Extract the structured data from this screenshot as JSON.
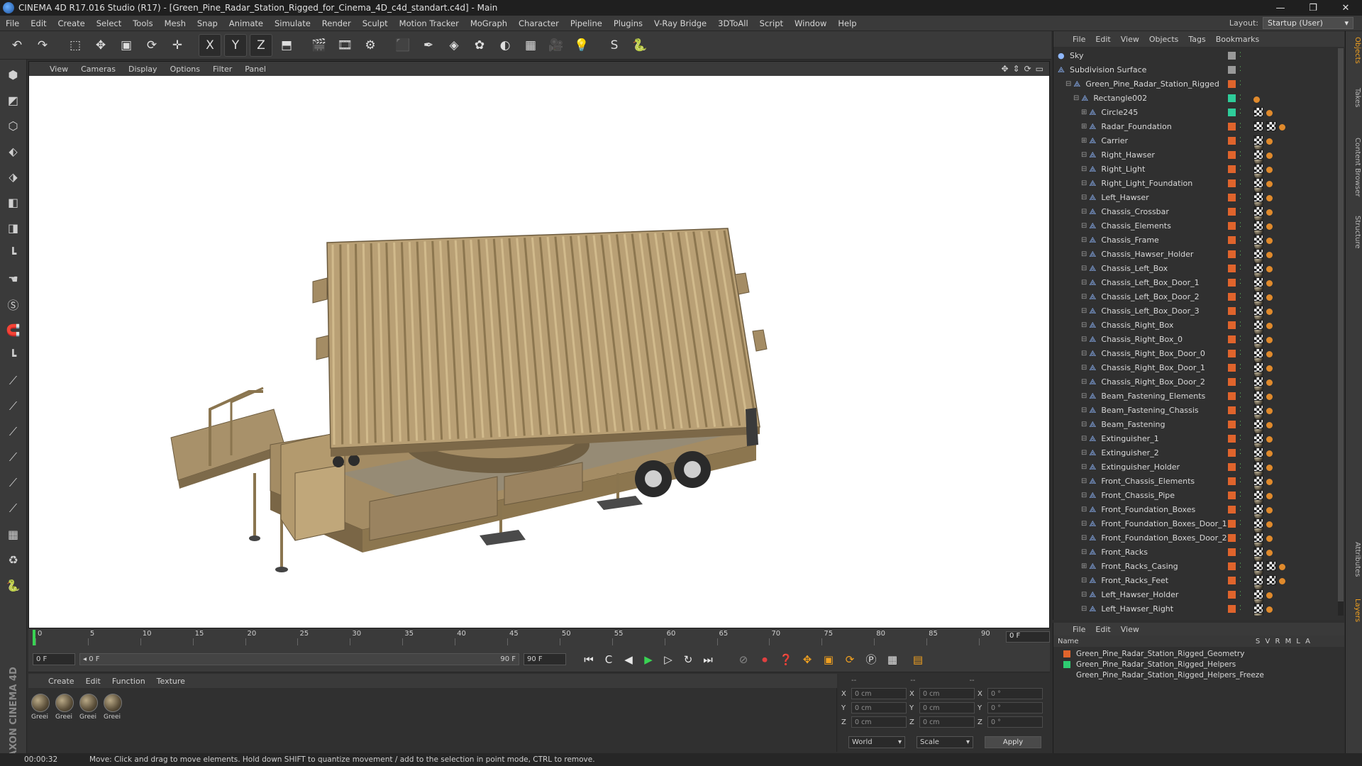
{
  "window": {
    "title": "CINEMA 4D R17.016 Studio (R17) - [Green_Pine_Radar_Station_Rigged_for_Cinema_4D_c4d_standart.c4d] - Main",
    "minimize": "—",
    "maximize": "❐",
    "close": "✕"
  },
  "menu": {
    "items": [
      "File",
      "Edit",
      "Create",
      "Select",
      "Tools",
      "Mesh",
      "Snap",
      "Animate",
      "Simulate",
      "Render",
      "Sculpt",
      "Motion Tracker",
      "MoGraph",
      "Character",
      "Pipeline",
      "Plugins",
      "V-Ray Bridge",
      "3DToAll",
      "Script",
      "Window",
      "Help"
    ],
    "layout_label": "Layout:",
    "layout_value": "Startup (User)"
  },
  "toolbar": {
    "icons": [
      {
        "name": "undo-icon",
        "glyph": "↶"
      },
      {
        "name": "redo-icon",
        "glyph": "↷"
      },
      {
        "name": "live-selection-icon",
        "glyph": "⬚"
      },
      {
        "name": "move-icon",
        "glyph": "✥"
      },
      {
        "name": "scale-icon",
        "glyph": "▣"
      },
      {
        "name": "rotate-icon",
        "glyph": "⟳"
      },
      {
        "name": "transform-icon",
        "glyph": "✛"
      },
      {
        "name": "x-axis-icon",
        "glyph": "X"
      },
      {
        "name": "y-axis-icon",
        "glyph": "Y"
      },
      {
        "name": "z-axis-icon",
        "glyph": "Z"
      },
      {
        "name": "coordinate-system-icon",
        "glyph": "⬒"
      },
      {
        "name": "render-view-icon",
        "glyph": "🎬"
      },
      {
        "name": "render-picture-viewer-icon",
        "glyph": "🎞"
      },
      {
        "name": "render-settings-icon",
        "glyph": "⚙"
      },
      {
        "name": "cube-icon",
        "glyph": "⬛"
      },
      {
        "name": "pen-icon",
        "glyph": "✒"
      },
      {
        "name": "subdivision-icon",
        "glyph": "◈"
      },
      {
        "name": "array-icon",
        "glyph": "✿"
      },
      {
        "name": "deformer-icon",
        "glyph": "◐"
      },
      {
        "name": "floor-icon",
        "glyph": "▦"
      },
      {
        "name": "camera-icon",
        "glyph": "🎥"
      },
      {
        "name": "light-icon",
        "glyph": "💡"
      },
      {
        "name": "sketch-icon",
        "glyph": "S"
      },
      {
        "name": "python-icon",
        "glyph": "🐍"
      }
    ]
  },
  "left_tools": [
    "⬢",
    "◩",
    "⬡",
    "⬖",
    "⬗",
    "◧",
    "◨",
    "┗",
    "☚",
    "Ⓢ",
    "🧲",
    "┗",
    "⟋",
    "⟋",
    "⟋",
    "⟋",
    "⟋",
    "⟋",
    "▦",
    "♻",
    "🐍"
  ],
  "maxon_logo": "MAXON CINEMA 4D",
  "viewport": {
    "menu": [
      "View",
      "Cameras",
      "Display",
      "Options",
      "Filter",
      "Panel"
    ],
    "nav_icons": [
      "✥",
      "⇕",
      "⟳",
      "▭"
    ]
  },
  "timeline": {
    "ticks": [
      "0",
      "5",
      "10",
      "15",
      "20",
      "25",
      "30",
      "35",
      "40",
      "45",
      "50",
      "55",
      "60",
      "65",
      "70",
      "75",
      "80",
      "85",
      "90"
    ],
    "current_frame": "0 F"
  },
  "transport": {
    "start_field": "0 F",
    "range_start": "◂ 0 F",
    "range_end": "90 F",
    "end_field": "90 F",
    "buttons": [
      "⏮",
      "C",
      "◀",
      "▶",
      "▷",
      "↻",
      "⏭"
    ]
  },
  "materials": {
    "menu": [
      "Create",
      "Edit",
      "Function",
      "Texture"
    ],
    "items": [
      "Greei",
      "Greei",
      "Greei",
      "Greei"
    ]
  },
  "coords": {
    "header": [
      "--",
      "--",
      "--"
    ],
    "rows": [
      {
        "a": "X",
        "v1": "0 cm",
        "b": "X",
        "v2": "0 cm",
        "c": "X",
        "v3": "0 °"
      },
      {
        "a": "Y",
        "v1": "0 cm",
        "b": "Y",
        "v2": "0 cm",
        "c": "Y",
        "v3": "0 °"
      },
      {
        "a": "Z",
        "v1": "0 cm",
        "b": "Z",
        "v2": "0 cm",
        "c": "Z",
        "v3": "0 °"
      }
    ],
    "world": "World",
    "scale": "Scale",
    "apply": "Apply"
  },
  "status": {
    "time": "00:00:32",
    "message": "Move: Click and drag to move elements. Hold down SHIFT to quantize movement / add to the selection in point mode, CTRL to remove."
  },
  "object_manager": {
    "menu": [
      "File",
      "Edit",
      "View",
      "Objects",
      "Tags",
      "Bookmarks"
    ],
    "objects": [
      {
        "name": "Sky",
        "indent": 0,
        "color": "#999999",
        "tags": []
      },
      {
        "name": "Subdivision Surface",
        "indent": 0,
        "color": "#999999",
        "tags": []
      },
      {
        "name": "Green_Pine_Radar_Station_Rigged",
        "indent": 1,
        "color": "#e0642c",
        "tags": []
      },
      {
        "name": "Rectangle002",
        "indent": 2,
        "color": "#2ecc9a",
        "tags": [
          "dot"
        ]
      },
      {
        "name": "Circle245",
        "indent": 3,
        "color": "#2ecc9a",
        "tags": [
          "chk",
          "dot"
        ]
      },
      {
        "name": "Radar_Foundation",
        "indent": 3,
        "color": "#e0642c",
        "tags": [
          "chk",
          "mat",
          "chk",
          "dot"
        ]
      },
      {
        "name": "Carrier",
        "indent": 3,
        "color": "#e0642c",
        "tags": [
          "mat",
          "chk",
          "dot"
        ]
      },
      {
        "name": "Right_Hawser",
        "indent": 3,
        "color": "#e0642c",
        "tags": [
          "mat",
          "chk",
          "dot"
        ]
      },
      {
        "name": "Right_Light",
        "indent": 3,
        "color": "#e0642c",
        "tags": [
          "mat",
          "chk",
          "dot"
        ]
      },
      {
        "name": "Right_Light_Foundation",
        "indent": 3,
        "color": "#e0642c",
        "tags": [
          "mat",
          "chk",
          "dot"
        ]
      },
      {
        "name": "Left_Hawser",
        "indent": 3,
        "color": "#e0642c",
        "tags": [
          "mat",
          "chk",
          "dot"
        ]
      },
      {
        "name": "Chassis_Crossbar",
        "indent": 3,
        "color": "#e0642c",
        "tags": [
          "mat",
          "chk",
          "dot"
        ]
      },
      {
        "name": "Chassis_Elements",
        "indent": 3,
        "color": "#e0642c",
        "tags": [
          "mat",
          "chk",
          "dot"
        ]
      },
      {
        "name": "Chassis_Frame",
        "indent": 3,
        "color": "#e0642c",
        "tags": [
          "mat",
          "chk",
          "dot"
        ]
      },
      {
        "name": "Chassis_Hawser_Holder",
        "indent": 3,
        "color": "#e0642c",
        "tags": [
          "mat",
          "chk",
          "dot"
        ]
      },
      {
        "name": "Chassis_Left_Box",
        "indent": 3,
        "color": "#e0642c",
        "tags": [
          "mat",
          "chk",
          "dot"
        ]
      },
      {
        "name": "Chassis_Left_Box_Door_1",
        "indent": 3,
        "color": "#e0642c",
        "tags": [
          "mat",
          "chk",
          "dot"
        ]
      },
      {
        "name": "Chassis_Left_Box_Door_2",
        "indent": 3,
        "color": "#e0642c",
        "tags": [
          "mat",
          "chk",
          "dot"
        ]
      },
      {
        "name": "Chassis_Left_Box_Door_3",
        "indent": 3,
        "color": "#e0642c",
        "tags": [
          "mat",
          "chk",
          "dot"
        ]
      },
      {
        "name": "Chassis_Right_Box",
        "indent": 3,
        "color": "#e0642c",
        "tags": [
          "mat",
          "chk",
          "dot"
        ]
      },
      {
        "name": "Chassis_Right_Box_0",
        "indent": 3,
        "color": "#e0642c",
        "tags": [
          "mat",
          "chk",
          "dot"
        ]
      },
      {
        "name": "Chassis_Right_Box_Door_0",
        "indent": 3,
        "color": "#e0642c",
        "tags": [
          "mat",
          "chk",
          "dot"
        ]
      },
      {
        "name": "Chassis_Right_Box_Door_1",
        "indent": 3,
        "color": "#e0642c",
        "tags": [
          "mat",
          "chk",
          "dot"
        ]
      },
      {
        "name": "Chassis_Right_Box_Door_2",
        "indent": 3,
        "color": "#e0642c",
        "tags": [
          "mat",
          "chk",
          "dot"
        ]
      },
      {
        "name": "Beam_Fastening_Elements",
        "indent": 3,
        "color": "#e0642c",
        "tags": [
          "mat",
          "chk",
          "dot"
        ]
      },
      {
        "name": "Beam_Fastening_Chassis",
        "indent": 3,
        "color": "#e0642c",
        "tags": [
          "mat",
          "chk",
          "dot"
        ]
      },
      {
        "name": "Beam_Fastening",
        "indent": 3,
        "color": "#e0642c",
        "tags": [
          "mat",
          "chk",
          "dot"
        ]
      },
      {
        "name": "Extinguisher_1",
        "indent": 3,
        "color": "#e0642c",
        "tags": [
          "mat",
          "chk",
          "dot"
        ]
      },
      {
        "name": "Extinguisher_2",
        "indent": 3,
        "color": "#e0642c",
        "tags": [
          "mat",
          "chk",
          "dot"
        ]
      },
      {
        "name": "Extinguisher_Holder",
        "indent": 3,
        "color": "#e0642c",
        "tags": [
          "mat",
          "chk",
          "dot"
        ]
      },
      {
        "name": "Front_Chassis_Elements",
        "indent": 3,
        "color": "#e0642c",
        "tags": [
          "mat",
          "chk",
          "dot"
        ]
      },
      {
        "name": "Front_Chassis_Pipe",
        "indent": 3,
        "color": "#e0642c",
        "tags": [
          "mat",
          "chk",
          "dot"
        ]
      },
      {
        "name": "Front_Foundation_Boxes",
        "indent": 3,
        "color": "#e0642c",
        "tags": [
          "mat",
          "chk",
          "dot"
        ]
      },
      {
        "name": "Front_Foundation_Boxes_Door_1",
        "indent": 3,
        "color": "#e0642c",
        "tags": [
          "mat",
          "chk",
          "dot"
        ]
      },
      {
        "name": "Front_Foundation_Boxes_Door_2",
        "indent": 3,
        "color": "#e0642c",
        "tags": [
          "mat",
          "chk",
          "dot"
        ]
      },
      {
        "name": "Front_Racks",
        "indent": 3,
        "color": "#e0642c",
        "tags": [
          "mat",
          "chk",
          "dot"
        ]
      },
      {
        "name": "Front_Racks_Casing",
        "indent": 3,
        "color": "#e0642c",
        "tags": [
          "chk",
          "mat",
          "chk",
          "dot"
        ]
      },
      {
        "name": "Front_Racks_Feet",
        "indent": 3,
        "color": "#e0642c",
        "tags": [
          "chk",
          "mat",
          "chk",
          "dot"
        ]
      },
      {
        "name": "Left_Hawser_Holder",
        "indent": 3,
        "color": "#e0642c",
        "tags": [
          "mat",
          "chk",
          "dot"
        ]
      },
      {
        "name": "Left_Hawser_Right",
        "indent": 3,
        "color": "#e0642c",
        "tags": [
          "mat",
          "chk",
          "dot"
        ]
      }
    ]
  },
  "layer_manager": {
    "menu": [
      "File",
      "Edit",
      "View"
    ],
    "header": "Name",
    "flags": "S V R M L A",
    "layers": [
      {
        "name": "Green_Pine_Radar_Station_Rigged_Geometry",
        "color": "#e0642c"
      },
      {
        "name": "Green_Pine_Radar_Station_Rigged_Helpers",
        "color": "#2ecc71"
      },
      {
        "name": "Green_Pine_Radar_Station_Rigged_Helpers_Freeze",
        "color": "#303030"
      }
    ]
  },
  "side_tabs": [
    "Objects",
    "Takes",
    "Content Browser",
    "Structure",
    "Attributes",
    "Layers"
  ],
  "colors": {
    "accent": "#e08a2c",
    "model": "#b79d6e",
    "model_dark": "#8c764f"
  }
}
